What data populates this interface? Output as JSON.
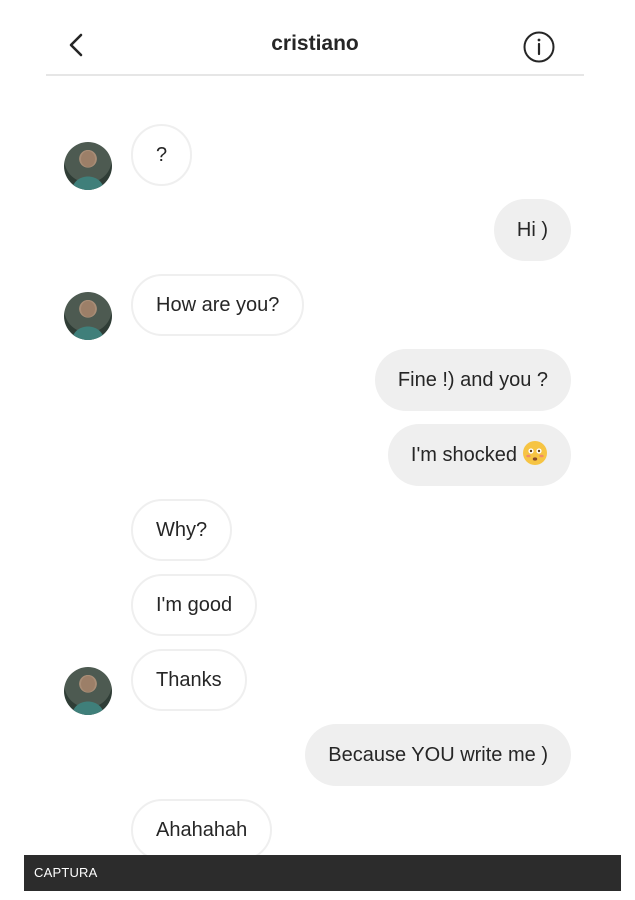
{
  "header": {
    "title": "cristiano",
    "back_icon": "chevron-left-icon",
    "info_icon": "info-circle-icon"
  },
  "messages": [
    {
      "from": "them",
      "text": "?",
      "avatar": true
    },
    {
      "from": "me",
      "text": "Hi )"
    },
    {
      "from": "them",
      "text": "How are you?",
      "avatar": true
    },
    {
      "from": "me",
      "text": "Fine !) and you ?"
    },
    {
      "from": "me",
      "text": "I'm shocked",
      "emoji": "flushed-face-icon"
    },
    {
      "from": "them",
      "text": "Why?"
    },
    {
      "from": "them",
      "text": "I'm good"
    },
    {
      "from": "them",
      "text": "Thanks",
      "avatar": true
    },
    {
      "from": "me",
      "text": "Because YOU write me )"
    },
    {
      "from": "them",
      "text": "Ahahahah"
    }
  ],
  "footer": {
    "label": "CAPTURA"
  },
  "colors": {
    "outgoing_bubble": "#efefef",
    "incoming_border": "#efefef",
    "text": "#262626",
    "footer_bg": "#2c2c2c"
  }
}
